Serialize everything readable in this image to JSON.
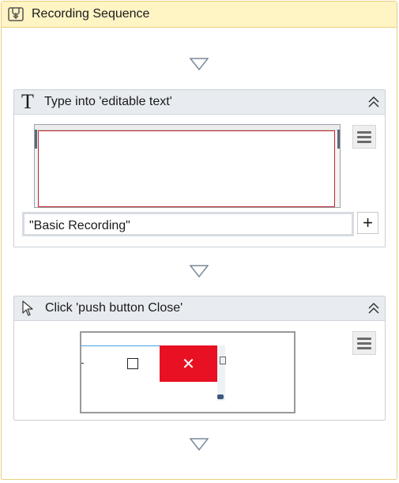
{
  "sequence": {
    "title": "Recording Sequence",
    "icon": "sequence-icon"
  },
  "activities": [
    {
      "title": "Type into 'editable text'",
      "icon": "text-type-icon",
      "icon_glyph": "T",
      "text_value": "\"Basic Recording\"",
      "add_label": "+"
    },
    {
      "title": "Click 'push button  Close'",
      "icon": "cursor-pointer-icon",
      "close_glyph": "✕"
    }
  ],
  "colors": {
    "sequence_header_bg": "#fff4c4",
    "sequence_border": "#e8cf7f",
    "activity_header_bg": "#e8ecf0",
    "close_button_red": "#e81123",
    "editor_border_red": "#c0262b"
  }
}
